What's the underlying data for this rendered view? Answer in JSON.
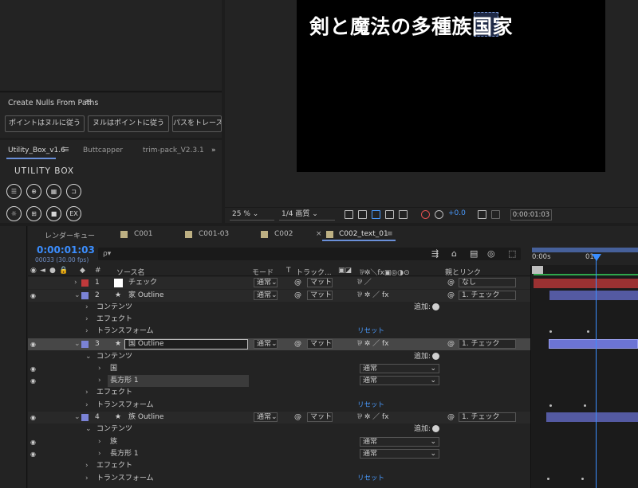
{
  "viewer": {
    "comp_text": "剣と魔法の多種族国家",
    "zoom": "25 %",
    "resolution": "1/4 画質",
    "exposure": "+0.0",
    "timecode": "0:00:01:03"
  },
  "nulls_panel": {
    "title": "Create Nulls From Paths",
    "buttons": [
      "ポイントはヌルに従う",
      "ヌルはポイントに従う",
      "パスをトレース"
    ]
  },
  "utility_panel": {
    "tabs": [
      "Utility_Box_v1.6",
      "Buttcapper",
      "trim-pack_V2.3.1"
    ],
    "logo": "UTILITY BOX",
    "ex_label": "EX"
  },
  "timeline": {
    "tabs": [
      {
        "label": "レンダーキュー"
      },
      {
        "label": "C001"
      },
      {
        "label": "C001-03"
      },
      {
        "label": "C002"
      },
      {
        "label": "C002_text_01"
      }
    ],
    "timecode": "0:00:01:03",
    "fps": "00033 (30.00 fps)",
    "search_placeholder": "ρ▾",
    "ruler": {
      "start": "0:00s",
      "mark": "01s"
    },
    "headers": {
      "num": "#",
      "source": "ソース名",
      "mode": "モード",
      "t": "T",
      "track": "トラック...",
      "parent": "親とリンク"
    },
    "add_label": "追加:",
    "reset_label": "リセット",
    "rows": [
      {
        "num": "1",
        "name": "チェック",
        "mode": "通常",
        "track": "マット",
        "parent": "なし"
      },
      {
        "num": "2",
        "name": "家 Outline",
        "mode": "通常",
        "track": "マット",
        "parent": "1. チェック"
      },
      {
        "label": "コンテンツ"
      },
      {
        "label": "エフェクト"
      },
      {
        "label": "トランスフォーム"
      },
      {
        "num": "3",
        "name": "国 Outline",
        "mode": "通常",
        "track": "マット",
        "parent": "1. チェック"
      },
      {
        "label": "コンテンツ"
      },
      {
        "label": "国",
        "mode": "通常"
      },
      {
        "label": "長方形 1",
        "mode": "通常"
      },
      {
        "label": "エフェクト"
      },
      {
        "label": "トランスフォーム"
      },
      {
        "num": "4",
        "name": "族 Outline",
        "mode": "通常",
        "track": "マット",
        "parent": "1. チェック"
      },
      {
        "label": "コンテンツ"
      },
      {
        "label": "族",
        "mode": "通常"
      },
      {
        "label": "長方形 1",
        "mode": "通常"
      },
      {
        "label": "エフェクト"
      },
      {
        "label": "トランスフォーム"
      }
    ],
    "colors": {
      "layer1": "#c0393b",
      "layer_shape": "#7b83d6",
      "accent": "#3b8eff"
    }
  }
}
